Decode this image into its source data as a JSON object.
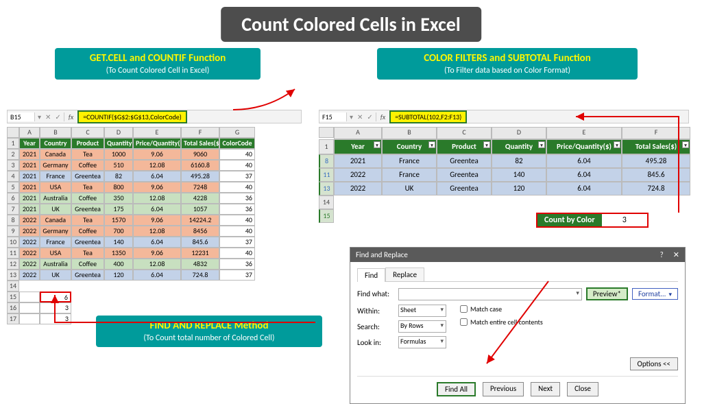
{
  "title": "Count Colored Cells in Excel",
  "sections": {
    "getcell": {
      "title": "GET.CELL and COUNTIF Function",
      "sub": "(To Count Colored Cell in Excel)"
    },
    "filter": {
      "title": "COLOR FILTERS and SUBTOTAL Function",
      "sub": "(To Filter data based on Color Format)"
    },
    "find": {
      "title": "FIND AND REPLACE Method",
      "sub": "(To Count total number of Colored Cell)"
    }
  },
  "left_bar": {
    "cell": "B15",
    "formula": "=COUNTIF($G$2:$G$13,ColorCode)"
  },
  "right_bar": {
    "cell": "F15",
    "formula": "=SUBTOTAL(102,F2:F13)"
  },
  "left_cols": [
    "A",
    "B",
    "C",
    "D",
    "E",
    "F",
    "G"
  ],
  "left_headers": [
    "Year",
    "Country",
    "Product",
    "Quantity",
    "Price/Quantity($)",
    "Total Sales($)",
    "ColorCode"
  ],
  "left_rows": [
    {
      "n": "2",
      "c": "c-salmon",
      "d": [
        "2021",
        "Canada",
        "Tea",
        "1000",
        "9.06",
        "9060"
      ],
      "cc": "40"
    },
    {
      "n": "3",
      "c": "c-salmon",
      "d": [
        "2021",
        "Germany",
        "Coffee",
        "510",
        "12.08",
        "6160.8"
      ],
      "cc": "40"
    },
    {
      "n": "4",
      "c": "c-blue",
      "d": [
        "2021",
        "France",
        "Greentea",
        "82",
        "6.04",
        "495.28"
      ],
      "cc": "37"
    },
    {
      "n": "5",
      "c": "c-salmon",
      "d": [
        "2021",
        "USA",
        "Tea",
        "800",
        "9.06",
        "7248"
      ],
      "cc": "40"
    },
    {
      "n": "6",
      "c": "c-green",
      "d": [
        "2021",
        "Australia",
        "Coffee",
        "350",
        "12.08",
        "4228"
      ],
      "cc": "36"
    },
    {
      "n": "7",
      "c": "c-green",
      "d": [
        "2021",
        "UK",
        "Greentea",
        "175",
        "6.04",
        "1057"
      ],
      "cc": "36"
    },
    {
      "n": "8",
      "c": "c-salmon",
      "d": [
        "2022",
        "Canada",
        "Tea",
        "1570",
        "9.06",
        "14224.2"
      ],
      "cc": "40"
    },
    {
      "n": "9",
      "c": "c-salmon",
      "d": [
        "2022",
        "Germany",
        "Coffee",
        "700",
        "12.08",
        "8456"
      ],
      "cc": "40"
    },
    {
      "n": "10",
      "c": "c-blue",
      "d": [
        "2022",
        "France",
        "Greentea",
        "140",
        "6.04",
        "845.6"
      ],
      "cc": "37"
    },
    {
      "n": "11",
      "c": "c-salmon",
      "d": [
        "2022",
        "USA",
        "Tea",
        "1350",
        "9.06",
        "12231"
      ],
      "cc": "40"
    },
    {
      "n": "12",
      "c": "c-green",
      "d": [
        "2022",
        "Australia",
        "Coffee",
        "400",
        "12.08",
        "4832"
      ],
      "cc": "36"
    },
    {
      "n": "13",
      "c": "c-blue",
      "d": [
        "2022",
        "UK",
        "Greentea",
        "120",
        "6.04",
        "724.8"
      ],
      "cc": "37"
    }
  ],
  "left_results": [
    {
      "n": "15",
      "v": "6",
      "sel": true
    },
    {
      "n": "16",
      "v": "3",
      "sel": false
    },
    {
      "n": "17",
      "v": "3",
      "sel": false
    }
  ],
  "right_cols": [
    "A",
    "B",
    "C",
    "D",
    "E",
    "F"
  ],
  "right_headers": [
    "Year",
    "Country",
    "Product",
    "Quantity",
    "Price/Quantity($)",
    "Total Sales($)"
  ],
  "right_rows": [
    {
      "n": "8",
      "d": [
        "2021",
        "France",
        "Greentea",
        "82",
        "6.04",
        "495.28"
      ]
    },
    {
      "n": "11",
      "d": [
        "2022",
        "France",
        "Greentea",
        "140",
        "6.04",
        "845.6"
      ]
    },
    {
      "n": "13",
      "d": [
        "2022",
        "UK",
        "Greentea",
        "120",
        "6.04",
        "724.8"
      ]
    }
  ],
  "right_empty": [
    "14",
    "15"
  ],
  "count_box": {
    "label": "Count by Color",
    "value": "3"
  },
  "dialog": {
    "title": "Find and Replace",
    "tabs": [
      "Find",
      "Replace"
    ],
    "find_what": "Find what:",
    "preview": "Preview*",
    "format": "Format...",
    "within": {
      "label": "Within:",
      "value": "Sheet"
    },
    "search": {
      "label": "Search:",
      "value": "By Rows"
    },
    "lookin": {
      "label": "Look in:",
      "value": "Formulas"
    },
    "match_case": "Match case",
    "match_entire": "Match entire cell contents",
    "options": "Options <<",
    "buttons": {
      "findall": "Find All",
      "prev": "Previous",
      "next": "Next",
      "close": "Close"
    }
  }
}
